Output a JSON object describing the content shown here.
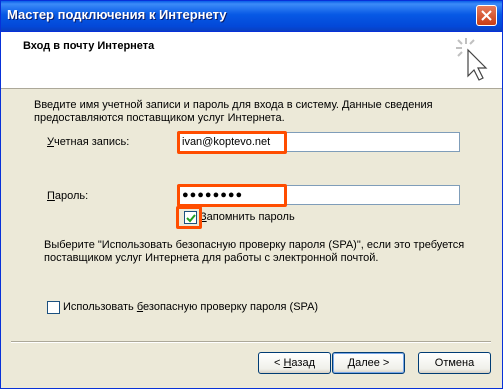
{
  "window": {
    "title": "Мастер подключения к Интернету"
  },
  "header": {
    "title": "Вход в почту Интернета"
  },
  "description": "Введите имя учетной записи и пароль для входа в систему. Данные сведения предоставляются поставщиком услуг Интернета.",
  "account": {
    "label_prefix": "У",
    "label_rest": "четная запись:",
    "value": "ivan@koptevo.net"
  },
  "password": {
    "label_prefix": "П",
    "label_rest": "ароль:",
    "value": "●●●●●●●●"
  },
  "remember": {
    "label_prefix": "З",
    "label_rest": "апомнить пароль",
    "checked": true
  },
  "spa": {
    "text": "Выберите \"Использовать безопасную проверку пароля (SPA)\", если это требуется поставщиком услуг Интернета для работы с электронной почтой.",
    "checkbox_label_a": "Использовать ",
    "checkbox_label_u": "б",
    "checkbox_label_b": "езопасную проверку пароля (SPA)",
    "checked": false
  },
  "buttons": {
    "back": {
      "prefix": "< ",
      "u": "Н",
      "rest": "азад"
    },
    "next": {
      "u": "Д",
      "rest": "алее >"
    },
    "cancel": "Отмена"
  },
  "colors": {
    "highlight": "#ff4d00",
    "titlebar": "#0a5fe8"
  }
}
